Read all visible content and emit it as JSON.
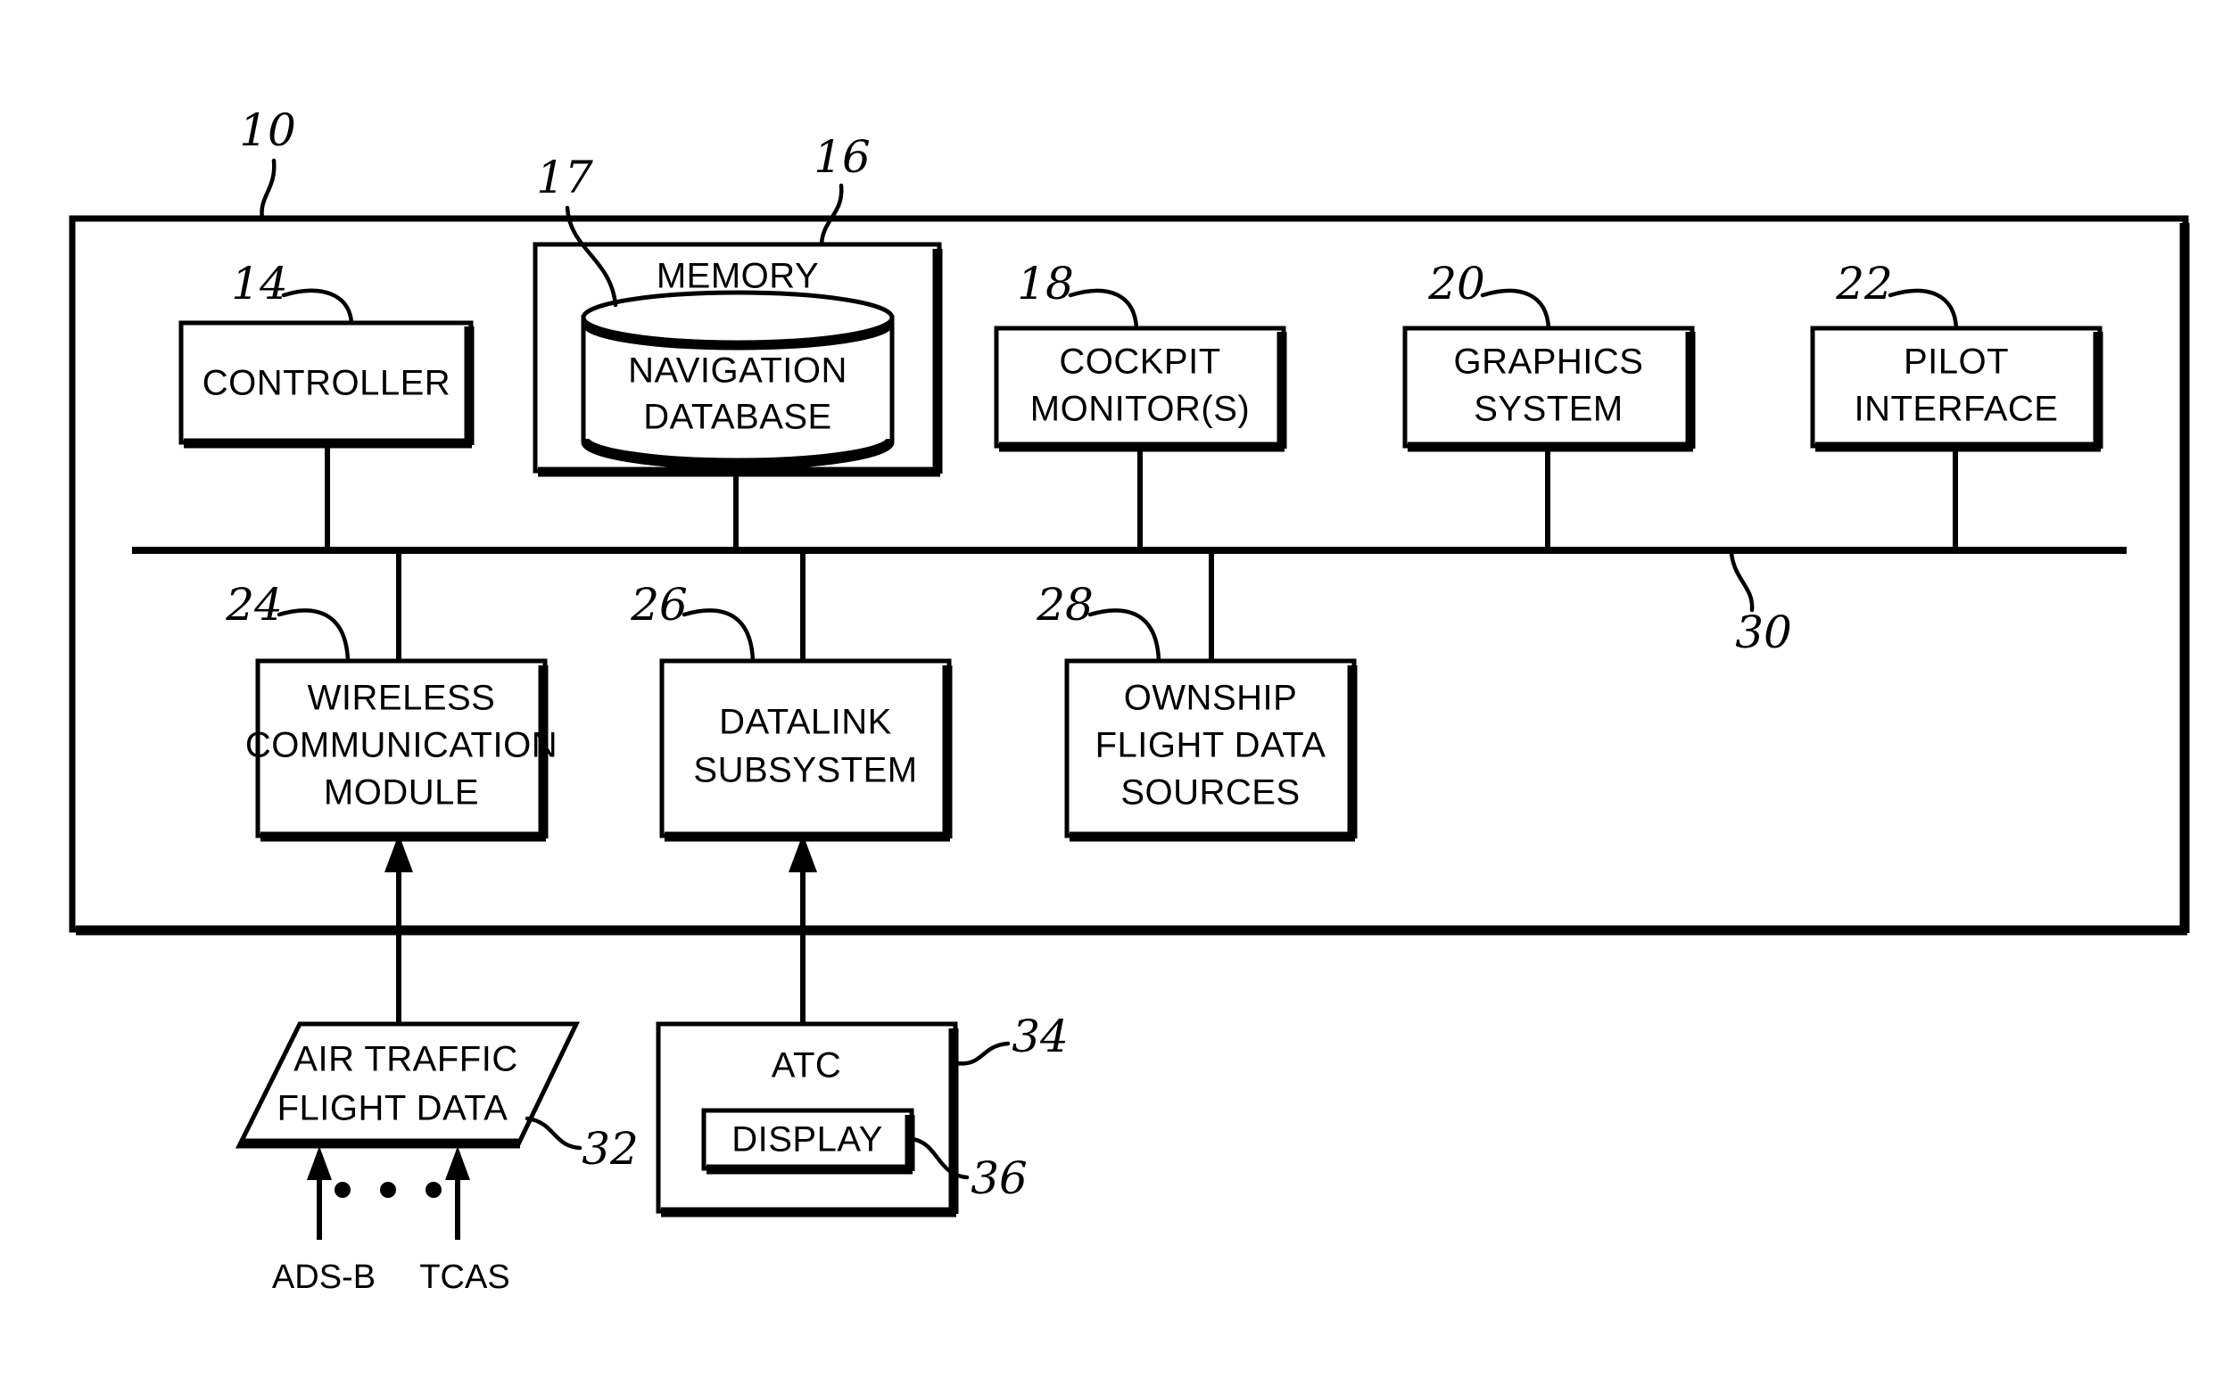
{
  "figure": {
    "title": "Avionics system block diagram",
    "style": "patent line drawing, black on white"
  },
  "system_frame": {
    "ref": "10",
    "name": "aircraft system enclosure"
  },
  "bus": {
    "ref": "30",
    "name": "data bus"
  },
  "top_row_blocks": [
    {
      "ref": "14",
      "label_lines": [
        "CONTROLLER"
      ],
      "shape": "rect"
    },
    {
      "ref": "16",
      "label_lines": [
        "MEMORY"
      ],
      "shape": "rect-container"
    },
    {
      "ref": "18",
      "label_lines": [
        "COCKPIT",
        "MONITOR(S)"
      ],
      "shape": "rect"
    },
    {
      "ref": "20",
      "label_lines": [
        "GRAPHICS",
        "SYSTEM"
      ],
      "shape": "rect"
    },
    {
      "ref": "22",
      "label_lines": [
        "PILOT",
        "INTERFACE"
      ],
      "shape": "rect"
    }
  ],
  "memory_inner": {
    "ref": "17",
    "label_lines": [
      "NAVIGATION",
      "DATABASE"
    ],
    "shape": "cylinder"
  },
  "bottom_row_blocks": [
    {
      "ref": "24",
      "label_lines": [
        "WIRELESS",
        "COMMUNICATION",
        "MODULE"
      ],
      "shape": "rect"
    },
    {
      "ref": "26",
      "label_lines": [
        "DATALINK",
        "SUBSYSTEM"
      ],
      "shape": "rect"
    },
    {
      "ref": "28",
      "label_lines": [
        "OWNSHIP",
        "FLIGHT DATA",
        "SOURCES"
      ],
      "shape": "rect"
    }
  ],
  "external_blocks": [
    {
      "ref": "32",
      "label_lines": [
        "AIR TRAFFIC",
        "FLIGHT DATA"
      ],
      "shape": "parallelogram"
    },
    {
      "ref": "34",
      "label_lines": [
        "ATC"
      ],
      "shape": "rect",
      "inner": {
        "ref": "36",
        "label_lines": [
          "DISPLAY"
        ],
        "shape": "rect"
      }
    }
  ],
  "source_labels": [
    {
      "label": "ADS-B"
    },
    {
      "label": "TCAS"
    }
  ],
  "ellipsis_dots": 3,
  "labels": {
    "controller": "CONTROLLER",
    "memory": "MEMORY",
    "nav_db_line1": "NAVIGATION",
    "nav_db_line2": "DATABASE",
    "cockpit_line1": "COCKPIT",
    "cockpit_line2": "MONITOR(S)",
    "graphics_line1": "GRAPHICS",
    "graphics_line2": "SYSTEM",
    "pilot_line1": "PILOT",
    "pilot_line2": "INTERFACE",
    "wireless_line1": "WIRELESS",
    "wireless_line2": "COMMUNICATION",
    "wireless_line3": "MODULE",
    "datalink_line1": "DATALINK",
    "datalink_line2": "SUBSYSTEM",
    "ownship_line1": "OWNSHIP",
    "ownship_line2": "FLIGHT DATA",
    "ownship_line3": "SOURCES",
    "atfd_line1": "AIR TRAFFIC",
    "atfd_line2": "FLIGHT DATA",
    "atc": "ATC",
    "display": "DISPLAY",
    "adsb": "ADS-B",
    "tcas": "TCAS"
  },
  "ref_numbers": {
    "n10": "10",
    "n14": "14",
    "n16": "16",
    "n17": "17",
    "n18": "18",
    "n20": "20",
    "n22": "22",
    "n24": "24",
    "n26": "26",
    "n28": "28",
    "n30": "30",
    "n32": "32",
    "n34": "34",
    "n36": "36"
  },
  "colors": {
    "ink": "#000000",
    "paper": "#ffffff"
  }
}
